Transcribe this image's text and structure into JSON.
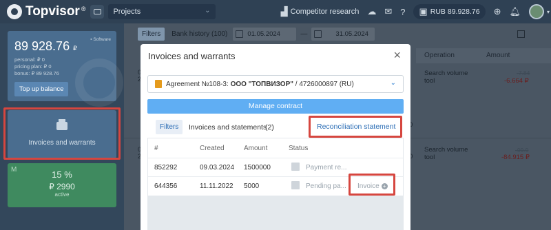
{
  "topbar": {
    "brand": "Topvisor",
    "brand_mark": "®",
    "project_select": "Projects",
    "competitor": "Competitor research",
    "balance": "RUB 89.928.76"
  },
  "sidebar": {
    "balance_amount": "89 928.76",
    "currency": "₽",
    "software_label": "Software",
    "personal": "personal:   ₽ 0",
    "pricing_plan": "pricing plan: ₽ 0",
    "bonus": "bonus: ₽ 89 928.76",
    "topup": "Top up balance",
    "invoices_label": "Invoices and warrants",
    "tariff_letter": "M",
    "tariff_percent": "15 %",
    "tariff_points": "₽ 2990",
    "tariff_status": "active"
  },
  "bg": {
    "filters": "Filters",
    "bank_history": "Bank history",
    "bank_history_count": "(100)",
    "date_from": "01.05.2024",
    "date_sep": "—",
    "date_to": "31.05.2024",
    "col_operation": "Operation",
    "col_amount": "Amount",
    "rows": [
      {
        "left": "06",
        "left2": "20",
        "op1": "Search volume",
        "op2": "tool",
        "old": "-7.84",
        "new": "-6.664 ₽",
        "mid": "0"
      },
      {
        "left": "06",
        "left2": "20",
        "op1": "Search volume",
        "op2": "tool",
        "old": "-99.9",
        "new": "-84.915 ₽",
        "mid": "0"
      }
    ]
  },
  "modal": {
    "title": "Invoices and warrants",
    "agreement_prefix": "Agreement №108-3:",
    "agreement_company": "ООО \"ТОПВИЗОР\"",
    "agreement_suffix": "/ 4726000897 (RU)",
    "manage": "Manage contract",
    "filters": "Filters",
    "tab_label": "Invoices and statements",
    "tab_count": "(2)",
    "reconciliation": "Reconciliation statement",
    "columns": {
      "num": "#",
      "created": "Created",
      "amount": "Amount",
      "status": "Status"
    },
    "rows": [
      {
        "num": "852292",
        "created": "09.03.2024",
        "amount": "1500000",
        "status": "Payment re..."
      },
      {
        "num": "644356",
        "created": "11.11.2022",
        "amount": "5000",
        "status": "Pending pa...",
        "action": "Invoice"
      }
    ]
  },
  "colors": {
    "highlight": "#d6463f",
    "link": "#2b6db5",
    "manage_button": "#60aef3",
    "sidebar_card": "#4a6d8f",
    "tariff_card": "#3f8a5f"
  }
}
